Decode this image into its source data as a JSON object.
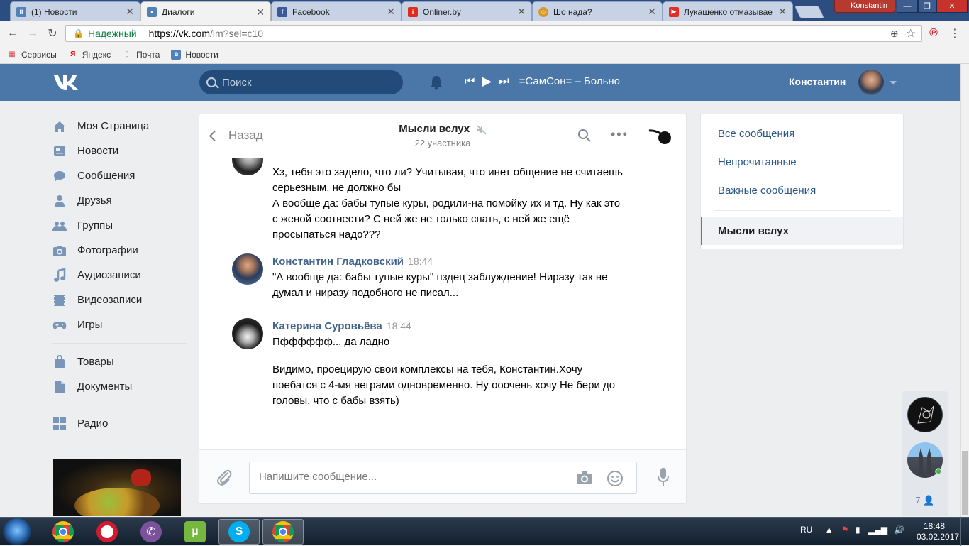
{
  "browser": {
    "tabs": [
      {
        "title": "(1) Новости",
        "icon": "vk-news-icon",
        "color": "#5181b8"
      },
      {
        "title": "Диалоги",
        "icon": "vk-dialogs-icon",
        "color": "#5181b8"
      },
      {
        "title": "Facebook",
        "icon": "facebook-icon",
        "color": "#3b5998"
      },
      {
        "title": "Onliner.by",
        "icon": "onliner-icon",
        "color": "#e02c1b"
      },
      {
        "title": "Шо нада?",
        "icon": "smiley-icon",
        "color": "#d69b2a"
      },
      {
        "title": "Лукашенко отмазывае",
        "icon": "youtube-icon",
        "color": "#e52d27"
      }
    ],
    "profile": "Konstantin",
    "address": {
      "secure_label": "Надежный",
      "host": "https://vk.com",
      "path": "/im?sel=c10"
    },
    "bookmarks": [
      "Сервисы",
      "Яндекс",
      "Почта",
      "Новости"
    ]
  },
  "vk": {
    "header": {
      "search_placeholder": "Поиск",
      "track": "=СамСон= – Больно",
      "user_name": "Константин"
    },
    "menu": [
      {
        "label": "Моя Страница",
        "icon": "home-icon"
      },
      {
        "label": "Новости",
        "icon": "news-icon"
      },
      {
        "label": "Сообщения",
        "icon": "messages-icon"
      },
      {
        "label": "Друзья",
        "icon": "friends-icon"
      },
      {
        "label": "Группы",
        "icon": "groups-icon"
      },
      {
        "label": "Фотографии",
        "icon": "photo-icon"
      },
      {
        "label": "Аудиозаписи",
        "icon": "music-icon"
      },
      {
        "label": "Видеозаписи",
        "icon": "video-icon"
      },
      {
        "label": "Игры",
        "icon": "games-icon"
      }
    ],
    "menu2": [
      {
        "label": "Товары",
        "icon": "bag-icon"
      },
      {
        "label": "Документы",
        "icon": "document-icon"
      }
    ],
    "menu3": [
      {
        "label": "Радио",
        "icon": "radio-icon"
      }
    ],
    "chat": {
      "back": "Назад",
      "title": "Мысли вслух",
      "subtitle": "22 участника",
      "messages": [
        {
          "author": "",
          "time": "",
          "lines": [
            "Хз, тебя это задело, что ли? Учитывая, что инет общение не считаешь серьезным, не должно бы",
            "А вообще да: бабы тупые куры, родили-на помойку их и тд. Ну как это с женой соотнести? С ней же не только спать, с ней же ещё просыпаться надо???"
          ]
        },
        {
          "author": "Константин Гладковский",
          "time": "18:44",
          "lines": [
            "\"А вообще да: бабы тупые куры\" пздец заблуждение! Ниразу так не думал и ниразу подобного не писал..."
          ]
        },
        {
          "author": "Катерина Суровьёва",
          "time": "18:44",
          "lines": [
            "Пфффффф... да ладно",
            "Видимо, проецирую свои комплексы на тебя, Константин.Хочу поебатся с 4-мя неграми одновременно. Ну ооочень хочу Не бери до головы, что с бабы взять)"
          ]
        }
      ],
      "composer_placeholder": "Напишите сообщение..."
    },
    "filters": {
      "items": [
        "Все сообщения",
        "Непрочитанные",
        "Важные сообщения"
      ],
      "active": "Мысли вслух"
    },
    "mini_count": "7"
  },
  "taskbar": {
    "lang": "RU",
    "time": "18:48",
    "date": "03.02.2017"
  },
  "colors": {
    "vk_blue": "#4a76a8",
    "link": "#2a5885",
    "author": "#42648b"
  }
}
